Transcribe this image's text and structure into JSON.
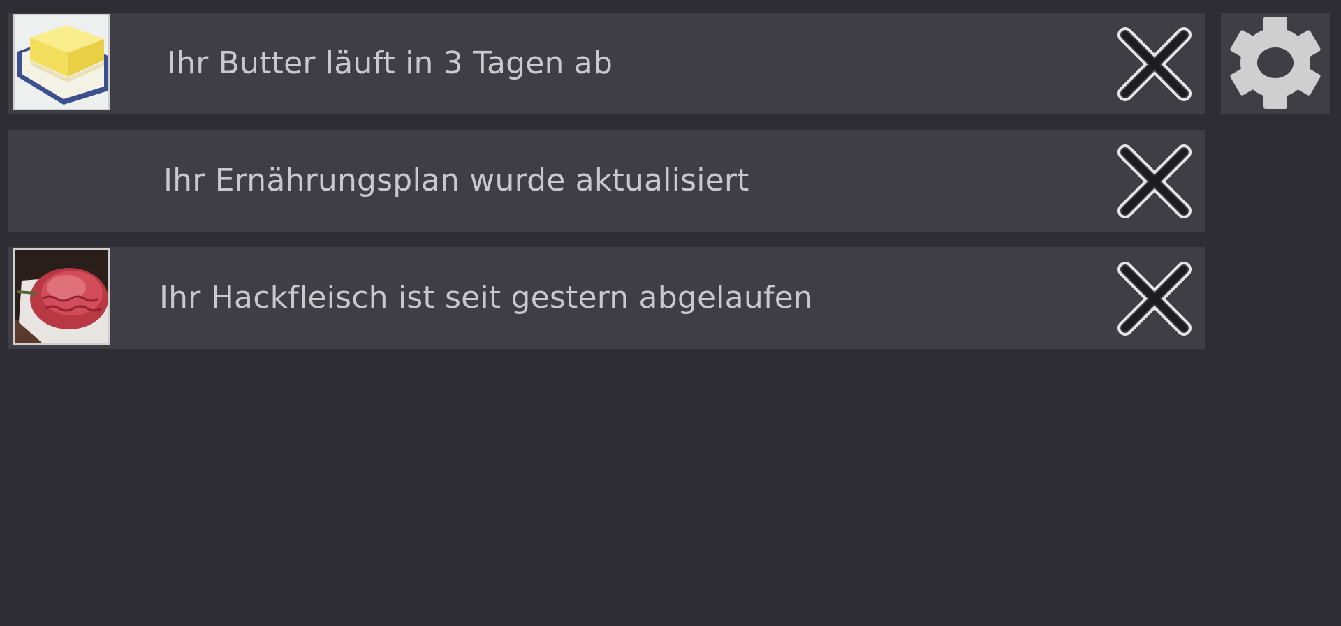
{
  "notifications": [
    {
      "id": "butter",
      "text": "Ihr Butter läuft in 3 Tagen ab",
      "thumbnail_icon": "butter-thumbnail",
      "has_thumbnail": true,
      "dismiss_icon": "close-icon"
    },
    {
      "id": "diet-plan",
      "text": "Ihr Ernährungsplan wurde aktualisiert",
      "has_thumbnail": false,
      "dismiss_icon": "close-icon"
    },
    {
      "id": "minced-meat",
      "text": "Ihr Hackfleisch ist seit gestern abgelaufen",
      "thumbnail_icon": "minced-meat-thumbnail",
      "has_thumbnail": true,
      "dismiss_icon": "close-icon"
    }
  ],
  "settings": {
    "icon": "gear-icon"
  },
  "colors": {
    "background": "#2e2d33",
    "panel": "#3f3e44",
    "text": "#c9c8cd",
    "icon": "#cfcfcf"
  }
}
